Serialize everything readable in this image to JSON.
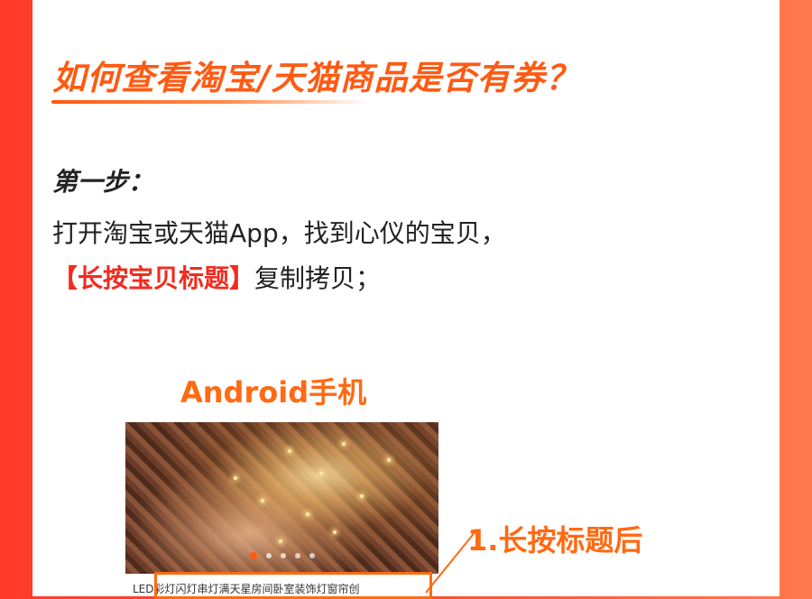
{
  "title": "如何查看淘宝/天猫商品是否有券？",
  "step": {
    "label": "第一步：",
    "text_part1": "打开淘宝或天猫App，找到心仪的宝贝，",
    "text_highlight": "【长按宝贝标题】",
    "text_part2": "复制拷贝；"
  },
  "android_label": "Android手机",
  "product": {
    "title": "LED彩灯闪灯串灯满天星房间卧室装饰灯窗帘创",
    "carousel_total": 5,
    "carousel_active": 1
  },
  "callout": "1.长按标题后",
  "colors": {
    "accent_orange": "#ff6a12",
    "highlight_red": "#f22b1f",
    "background_red": "#ff3a2a"
  }
}
